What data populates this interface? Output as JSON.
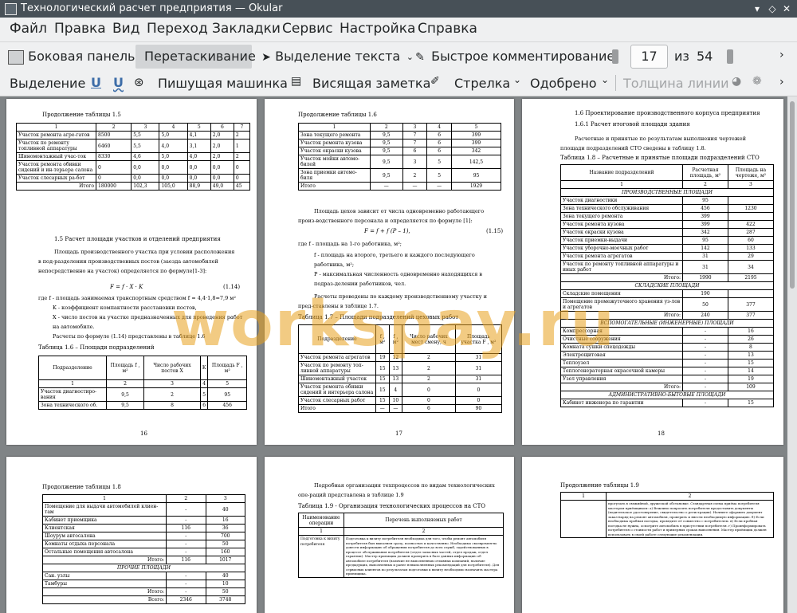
{
  "window": {
    "title": "Технологический расчет предприятия  — Okular"
  },
  "menu": [
    "Файл",
    "Правка",
    "Вид",
    "Переход",
    "Закладки",
    "Сервис",
    "Настройка",
    "Справка"
  ],
  "toolbar1": {
    "sidebar": "Боковая панель",
    "drag": "Перетаскивание",
    "text_select": "Выделение текста",
    "quick_comment": "Быстрое комментирование",
    "page_current": "17",
    "page_of": "из",
    "page_total": "54"
  },
  "toolbar2": {
    "select": "Выделение",
    "u1": "U",
    "u2": "U",
    "typewriter": "Пишущая машинка",
    "note": "Висящая заметка",
    "arrow": "Стрелка",
    "approved": "Одобрено",
    "line_width": "Толщина линии"
  },
  "watermark": "workspay.ru",
  "page16": {
    "caption_a": "Продолжение таблицы 1.5",
    "t15_head": [
      "1",
      "2",
      "3",
      "4",
      "5",
      "6",
      "7"
    ],
    "t15_rows": [
      [
        "Участок ремонта агре-гатов",
        "8500",
        "5,5",
        "5,0",
        "4,1",
        "2,0",
        "2"
      ],
      [
        "Участок по ремонту топливной аппаратуры",
        "6460",
        "5,5",
        "4,0",
        "3,1",
        "2,0",
        "1"
      ],
      [
        "Шиномонтажный учас-ток",
        "8330",
        "4,6",
        "5,0",
        "4,0",
        "2,0",
        "2"
      ],
      [
        "Участок ремонта обивки сидений и ин-терьера салона",
        "0",
        "0,0",
        "0,0",
        "0,0",
        "0,0",
        "0"
      ],
      [
        "Участок слесарных ра-бот",
        "0",
        "0,0",
        "0,0",
        "0,0",
        "0,0",
        "0"
      ],
      [
        "Итого",
        "180000",
        "102,3",
        "105,0",
        "88,9",
        "49,0",
        "45"
      ]
    ],
    "section": "1.5 Расчет площади участков и отделений предприятия",
    "para1": "Площадь производственного участка при условии расположения в под-разделении производственных постов (заезда автомобилей непосредственно на участок) определяется по формуле[1-3]:",
    "formula": "F = f  · X  · K",
    "formula_no": "(1.14)",
    "where1": "где  f  - площадь занимаемая транспортным средством  f  = 4,4·1,8=7,9  м²",
    "where2": "K  - коэффициент компактности расстановки постов,",
    "where3": "X  - число постов на участке предназначенных для проведения работ на автомобиле.",
    "para2": "Расчеты по формуле (1.14) представлены в таблице 1.6",
    "caption_b": "Таблица 1.6 – Площади подразделений",
    "t16_head": [
      "Подразделение",
      "Площадь f , м²",
      "Число рабочих постов X",
      "K",
      "Площадь F , м²"
    ],
    "t16_nums": [
      "1",
      "2",
      "3",
      "4",
      "5"
    ],
    "t16_rows": [
      [
        "Участок диагностиро-вания",
        "9,5",
        "2",
        "5",
        "95"
      ],
      [
        "Зона технического об.",
        "9,5",
        "8",
        "6",
        "456"
      ]
    ],
    "page_num": "16"
  },
  "page17": {
    "caption_a": "Продолжение таблицы 1.6",
    "t_head": [
      "1",
      "2",
      "3",
      "4",
      "5"
    ],
    "t_rows": [
      [
        "Зона текущего ремонта",
        "9,5",
        "7",
        "6",
        "399"
      ],
      [
        "Участок ремонта кузова",
        "9,5",
        "7",
        "6",
        "399"
      ],
      [
        "Участок окраски кузова",
        "9,5",
        "6",
        "6",
        "342"
      ],
      [
        "Участок мойки автомо-билей",
        "9,5",
        "3",
        "5",
        "142,5"
      ],
      [
        "Зона приемки автомо-биля",
        "9,5",
        "2",
        "5",
        "95"
      ],
      [
        "Итого",
        "—",
        "—",
        "—",
        "1929"
      ]
    ],
    "para1": "Площадь цехов зависит от числа одновременно работающего произ-водственного персонала и определяется по формуле [1]:",
    "formula": "F  = f  + f (P  – 1),",
    "formula_no": "(1.15)",
    "where1": "где f  - площадь на 1-го работника, м²;",
    "where2": "f  - площадь на второго, третьего и каждого последующего работника, м²;",
    "where3": "P  - максимальная численность одновременно находящихся в подраз-делении работников, чел.",
    "para2": "Расчеты проведены по каждому производственному участку и пред-ставлены в таблице 1.7.",
    "caption_b": "Таблица 1.7 – Площади подразделений цеховых работ",
    "t17_head": [
      "Подразделение",
      "f , м²",
      "f , м²",
      "Число рабочих мест смену, ч",
      "Площадь участка F , м²"
    ],
    "t17_rows": [
      [
        "Участок ремонта агрегатов",
        "19",
        "12",
        "2",
        "31"
      ],
      [
        "Участок по ремонту топ-ливной аппаратуры",
        "15",
        "13",
        "2",
        "31"
      ],
      [
        "Шиномонтажный участок",
        "15",
        "13",
        "2",
        "31"
      ],
      [
        "Участок ремонта обивки сидений и интерьера салона",
        "15",
        "4",
        "0",
        "0"
      ],
      [
        "Участок слесарных работ",
        "15",
        "10",
        "0",
        "0"
      ],
      [
        "Итого",
        "—",
        "—",
        "6",
        "90"
      ]
    ],
    "page_num": "17"
  },
  "page18": {
    "h1": "1.6 Проектирование производственного корпуса предприятия",
    "h2": "1.6.1 Расчет итоговой площади здания",
    "para1": "Расчетные и принятые по результатам выполнения чертежей площади подразделений СТО сведены в таблицу 1.8.",
    "caption": "Таблица 1.8 – Расчетные и принятые площади подразделений СТО",
    "head": [
      "Название подразделений",
      "Расчетная площадь, м²",
      "Площадь на чертеже, м²"
    ],
    "head_nums": [
      "1",
      "2",
      "3"
    ],
    "sec_prod": "ПРОИЗВОДСТВЕННЫЕ ПЛОЩАДИ",
    "rows_prod": [
      [
        "Участок диагностики",
        "95",
        ""
      ],
      [
        "Зона технического обслуживания",
        "456",
        "1230"
      ],
      [
        "Зона текущего ремонта",
        "399",
        ""
      ],
      [
        "Участок ремонта кузова",
        "399",
        "422"
      ],
      [
        "Участок окраски кузова",
        "342",
        "287"
      ],
      [
        "Участок приемки-выдачи",
        "95",
        "60"
      ],
      [
        "Участок уборочно-моечных работ",
        "142",
        "133"
      ],
      [
        "Участок ремонта агрегатов",
        "31",
        "29"
      ],
      [
        "Участок по ремонту топливной аппаратуры и иных работ",
        "31",
        "34"
      ],
      [
        "Итого:",
        "1990",
        "2195"
      ]
    ],
    "sec_store": "СКЛАДСКИЕ ПЛОЩАДИ",
    "rows_store": [
      [
        "Складские помещения",
        "190",
        ""
      ],
      [
        "Помещение промежуточного хранения уз-лов и агрегатов",
        "50",
        "377"
      ],
      [
        "Итого:",
        "240",
        "377"
      ]
    ],
    "sec_aux": "ВСПОМОГАТЕЛЬНЫЕ (ИНЖЕНЕРНЫЕ) ПЛОЩАДИ",
    "rows_aux": [
      [
        "Компрессорная",
        "-",
        "16"
      ],
      [
        "Очистные сооружения",
        "-",
        "26"
      ],
      [
        "Комната сушки спецодежды",
        "-",
        "8"
      ],
      [
        "Электрощитовая",
        "-",
        "13"
      ],
      [
        "Теплоузел",
        "-",
        "15"
      ],
      [
        "Теплогенераторная окрасочной камеры",
        "-",
        "14"
      ],
      [
        "Узел управления",
        "-",
        "19"
      ],
      [
        "Итого:",
        "-",
        "109"
      ]
    ],
    "sec_adm": "АДМИНИСТРАТИВНО-БЫТОВЫЕ ПЛОЩАДИ",
    "rows_adm": [
      [
        "Кабинет инженера по гарантии",
        "-",
        "15"
      ]
    ],
    "page_num": "18"
  },
  "page19": {
    "caption": "Продолжение таблицы 1.8",
    "head": [
      "1",
      "2",
      "3"
    ],
    "rows_a": [
      [
        "Помещение для выдачи автомобилей клиен-там",
        "-",
        "40"
      ],
      [
        "Кабинет приемщика",
        "-",
        "16"
      ],
      [
        "Клиентская",
        "116",
        "36"
      ],
      [
        "Шоурум автосалона",
        "-",
        "700"
      ],
      [
        "Комнаты отдыха персонала",
        "-",
        "50"
      ],
      [
        "Остальные помещения автосалона",
        "-",
        "160"
      ],
      [
        "Итого:",
        "116",
        "1017"
      ]
    ],
    "sec_other": "ПРОЧИЕ ПЛОЩАДИ",
    "rows_b": [
      [
        "Сан. узлы",
        "-",
        "40"
      ],
      [
        "Тамбуры",
        "-",
        "10"
      ],
      [
        "Итого:",
        "-",
        "50"
      ],
      [
        "Всего:",
        "2346",
        "3748"
      ]
    ]
  },
  "page20": {
    "para": "Подробная организация техпроцессов по видам технологических опе-раций представлена в таблице 1.9",
    "caption": "Таблица 1.9 - Организация технологических процессов на СТО",
    "head": [
      "Наименование операции",
      "Перечень выполняемых работ"
    ],
    "head_nums": [
      "1",
      "2"
    ],
    "op": "Подготовка к визиту потребителя",
    "text": "Подготовка к визиту потребителя необходима для того, чтобы ремонт автомобиля потребителя был выполнен сразу, полностью и качественно. Необходимо своевремен-но довести информацию об обращении потребителя до всех служб, задействованных в процессе обслуживания потребителя (отдел запасных частей, отдел продаж, отдел гарантии). Мастер приемщик должен проверить в базе данных информацию об автомобиле потребителя (наличие не выполненных отзывных компаний, наличие предыдущих, выполненных и ранее невыполненных рекомендаций для потребителя). Для сервисных клиентов по результатам подготовки к визиту необходимо назначить мастера приемщика."
  },
  "page21": {
    "caption": "Продолжение таблицы 1.9",
    "head": [
      "1",
      "2"
    ],
    "text": "прогулать в свежийной, дружеской обстановке. Стандартная схема приёма потребителя мастером приёмщиком: а) Вежливо попросить потребителя предоставить документы (водительское удостоверение, свидетельство о регистрации). Начните оформить документ заказ-наряд на ремонт автомобиля, проверить и внести необходимую информацию. б) Если необходима пробная поездка, проведите её совместно с потребителем. в) Если пробная поездка не нужна, осмотрите автомобиль в присутствии потребителя. г) Проинформировать потребителя о стоимости работ и примерных сроках выполнения. Мастер приёмщик должен использовать в своей работе следующие рекомендации."
  }
}
